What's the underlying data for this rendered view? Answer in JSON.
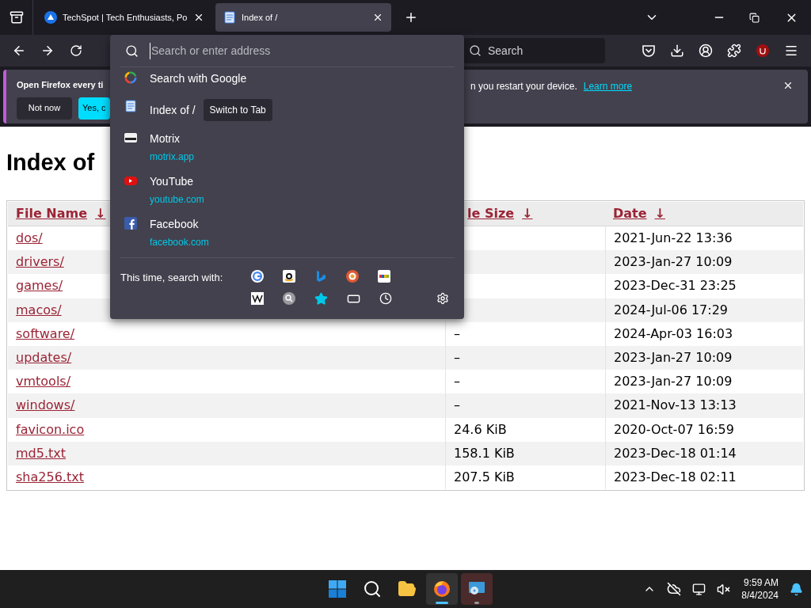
{
  "tabs": [
    {
      "title": "TechSpot | Tech Enthusiasts, Po",
      "selected": false
    },
    {
      "title": "Index of /",
      "selected": true
    }
  ],
  "toolbar": {
    "search_placeholder": "Search"
  },
  "notification": {
    "message_start": "Open Firefox every ti",
    "message_end": "n you restart your device.",
    "link": "Learn more",
    "buttons": [
      "Not now",
      "Yes, c"
    ]
  },
  "address_popup": {
    "placeholder": "Search or enter address",
    "results": [
      {
        "kind": "search",
        "title": "Search with Google"
      },
      {
        "kind": "tab",
        "title": "Index of /",
        "action": "Switch to Tab"
      },
      {
        "kind": "site",
        "title": "Motrix",
        "url": "motrix.app"
      },
      {
        "kind": "site",
        "title": "YouTube",
        "url": "youtube.com"
      },
      {
        "kind": "site",
        "title": "Facebook",
        "url": "facebook.com"
      }
    ],
    "engines_label": "This time, search with:"
  },
  "page": {
    "heading": "Index of",
    "table": {
      "columns": [
        {
          "label": "File Name",
          "sort": "↓"
        },
        {
          "label": "le Size",
          "sort": "↓"
        },
        {
          "label": "Date",
          "sort": "↓"
        }
      ],
      "rows": [
        {
          "name": "dos/",
          "date": "2021-Jun-22 13:36"
        },
        {
          "name": "drivers/",
          "date": "2023-Jan-27 10:09"
        },
        {
          "name": "games/",
          "date": "2023-Dec-31 23:25"
        },
        {
          "name": "macos/",
          "date": "2024-Jul-06 17:29"
        },
        {
          "name": "software/",
          "size": "–",
          "date": "2024-Apr-03 16:03"
        },
        {
          "name": "updates/",
          "size": "–",
          "date": "2023-Jan-27 10:09"
        },
        {
          "name": "vmtools/",
          "size": "–",
          "date": "2023-Jan-27 10:09"
        },
        {
          "name": "windows/",
          "size": "–",
          "date": "2021-Nov-13 13:13"
        },
        {
          "name": "favicon.ico",
          "size": "24.6 KiB",
          "date": "2020-Oct-07 16:59"
        },
        {
          "name": "md5.txt",
          "size": "158.1 KiB",
          "date": "2023-Dec-18 01:14"
        },
        {
          "name": "sha256.txt",
          "size": "207.5 KiB",
          "date": "2023-Dec-18 02:11"
        }
      ]
    }
  },
  "taskbar": {
    "apps": [
      {
        "selected": false,
        "running": false
      },
      {
        "selected": false,
        "running": false
      },
      {
        "selected": false,
        "running": false
      },
      {
        "selected": true
      },
      {
        "selected": false,
        "running": true
      }
    ],
    "time": "9:59 AM",
    "date": "8/4/2024"
  }
}
